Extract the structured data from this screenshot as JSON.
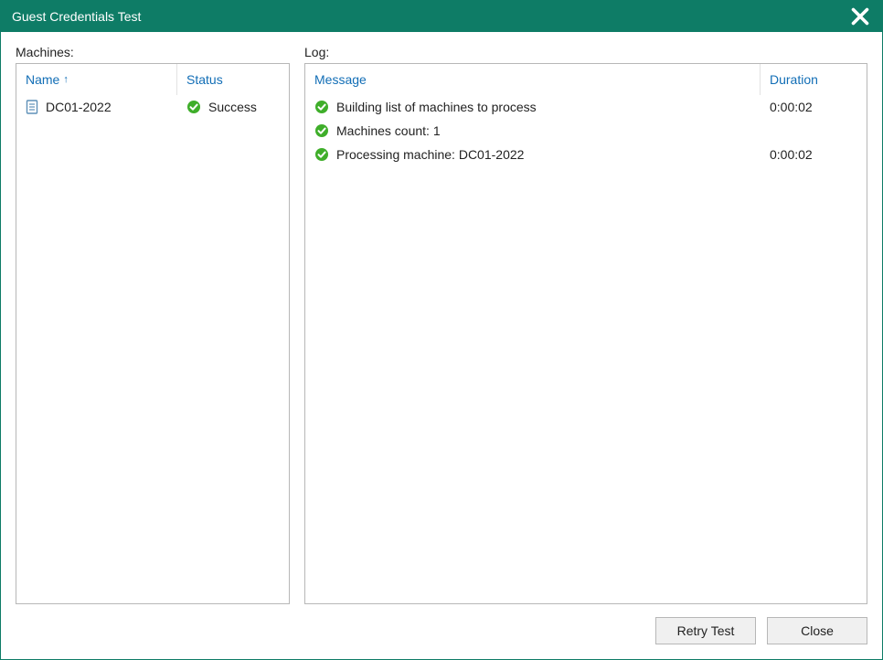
{
  "titlebar": {
    "title": "Guest Credentials Test",
    "close_label": "✕"
  },
  "machines": {
    "section_label": "Machines:",
    "columns": {
      "name": "Name",
      "status": "Status"
    },
    "rows": [
      {
        "name": "DC01-2022",
        "status": "Success",
        "status_icon": "success"
      }
    ]
  },
  "log": {
    "section_label": "Log:",
    "columns": {
      "message": "Message",
      "duration": "Duration"
    },
    "rows": [
      {
        "icon": "success",
        "message": "Building list of machines to process",
        "duration": "0:00:02"
      },
      {
        "icon": "success",
        "message": "Machines count: 1",
        "duration": ""
      },
      {
        "icon": "success",
        "message": "Processing machine: DC01-2022",
        "duration": "0:00:02"
      }
    ]
  },
  "buttons": {
    "retry": "Retry Test",
    "close": "Close"
  }
}
